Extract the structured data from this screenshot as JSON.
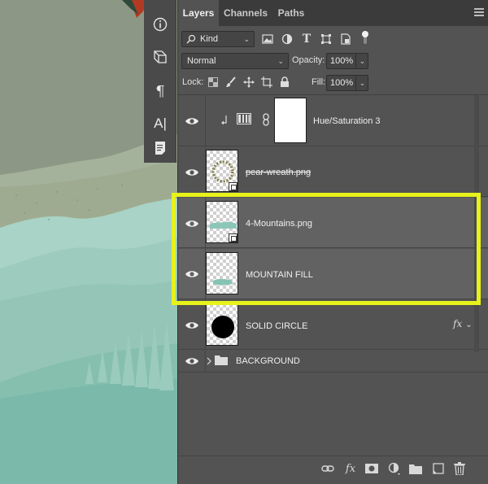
{
  "tabs": [
    {
      "label": "Layers",
      "active": true
    },
    {
      "label": "Channels",
      "active": false
    },
    {
      "label": "Paths",
      "active": false
    }
  ],
  "filter": {
    "kind_label": "Kind"
  },
  "blend": {
    "mode": "Normal",
    "opacity_label": "Opacity:",
    "opacity_value": "100%"
  },
  "lock": {
    "label": "Lock:",
    "fill_label": "Fill:",
    "fill_value": "100%"
  },
  "layers": [
    {
      "name": "Hue/Saturation 3",
      "type": "adjustment",
      "selected": false
    },
    {
      "name": "pear-wreath.png",
      "type": "smart-object",
      "selected": false,
      "strikethrough": true
    },
    {
      "name": "4-Mountains.png",
      "type": "smart-object",
      "selected": true
    },
    {
      "name": "MOUNTAIN FILL",
      "type": "pixel",
      "selected": true
    },
    {
      "name": "SOLID CIRCLE",
      "type": "pixel",
      "selected": false,
      "fx": "fx"
    },
    {
      "name": "BACKGROUND",
      "type": "group",
      "selected": false
    }
  ],
  "colors": {
    "panel_bg": "#535353",
    "selected_bg": "#626262",
    "highlight": "#e6f21a",
    "canvas_top": "#8c9885",
    "canvas_mountain": "#9fcbc0",
    "canvas_base": "#7bb9ab"
  },
  "toolstrip": [
    "info-icon",
    "3d-icon",
    "paragraph-icon",
    "character-icon",
    "notes-icon"
  ],
  "toolstrip_text": {
    "paragraph": "¶",
    "character": "A|"
  },
  "footer_icons": [
    "link-icon",
    "fx-icon",
    "mask-icon",
    "adjustment-icon",
    "folder-icon",
    "new-layer-icon",
    "trash-icon"
  ]
}
